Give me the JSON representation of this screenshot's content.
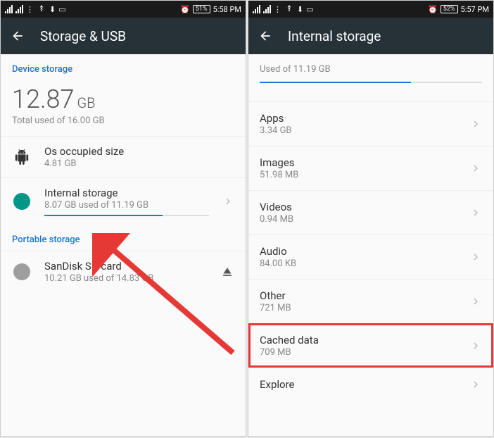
{
  "left": {
    "statusbar": {
      "battery": "51%",
      "time": "5:58 PM"
    },
    "appbar_title": "Storage & USB",
    "section_device": "Device storage",
    "total_value": "12.87",
    "total_unit": "GB",
    "total_sub": "Total used of 16.00 GB",
    "os_row": {
      "title": "Os occupied size",
      "sub": "4.81 GB"
    },
    "internal_row": {
      "title": "Internal storage",
      "sub": "8.07 GB used of 11.19 GB"
    },
    "section_portable": "Portable storage",
    "sd_row": {
      "title": "SanDisk SD card",
      "sub": "10.21 GB used of 14.83 GB"
    }
  },
  "right": {
    "statusbar": {
      "battery": "52%",
      "time": "5:57 PM"
    },
    "appbar_title": "Internal storage",
    "header_sub": "Used of 11.19 GB",
    "rows": {
      "apps": {
        "title": "Apps",
        "sub": "3.34 GB"
      },
      "images": {
        "title": "Images",
        "sub": "51.98 MB"
      },
      "videos": {
        "title": "Videos",
        "sub": "0.94 MB"
      },
      "audio": {
        "title": "Audio",
        "sub": "84.00 KB"
      },
      "other": {
        "title": "Other",
        "sub": "721 MB"
      },
      "cached": {
        "title": "Cached data",
        "sub": "709 MB"
      },
      "explore": {
        "title": "Explore",
        "sub": ""
      }
    }
  }
}
